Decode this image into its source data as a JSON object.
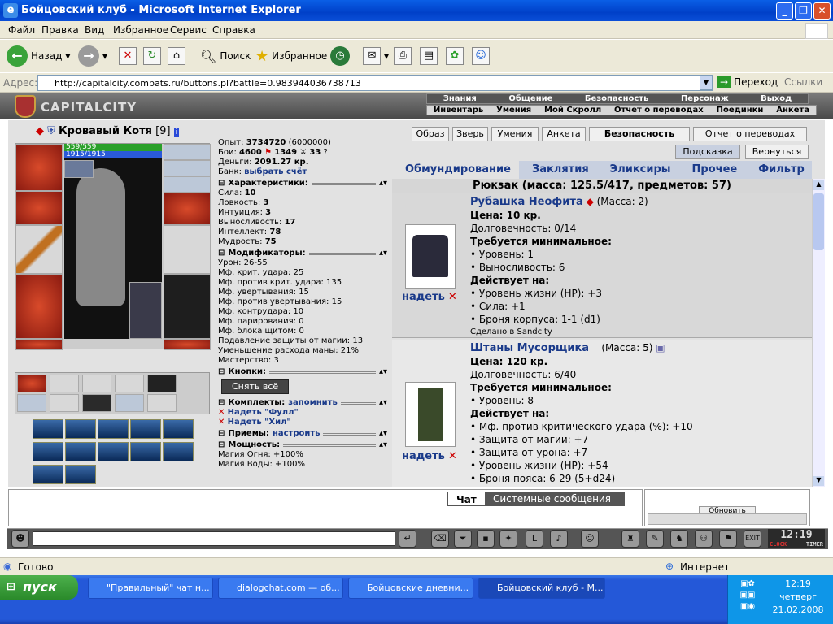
{
  "window": {
    "title": "Бойцовский клуб - Microsoft Internet Explorer"
  },
  "menu": [
    "Файл",
    "Правка",
    "Вид",
    "Избранное",
    "Сервис",
    "Справка"
  ],
  "toolbar": {
    "back": "Назад",
    "search": "Поиск",
    "favorites": "Избранное"
  },
  "address": {
    "label": "Адрес:",
    "url": "http://capitalcity.combats.ru/buttons.pl?battle=0.983944036738713",
    "go": "Переход",
    "links": "Ссылки"
  },
  "game": {
    "logo": "CAPITALCITY",
    "nav_top": [
      "Знания",
      "Общение",
      "Безопасность",
      "Персонаж",
      "Выход"
    ],
    "nav_bottom": [
      "Инвентарь",
      "Умения",
      "Мой Скролл",
      "Отчет о переводах",
      "Поединки",
      "Анкета"
    ]
  },
  "character": {
    "name": "Кровавый Котя",
    "level": "[9]",
    "hp": "559/559",
    "mana": "1915/1915",
    "exp_label": "Опыт:",
    "exp": "3734720",
    "exp_next": "(6000000)",
    "fights_label": "Бои:",
    "wins": "4600",
    "losses": "1349",
    "draws": "33",
    "money_label": "Деньги:",
    "money": "2091.27 кр.",
    "bank_label": "Банк:",
    "bank": "выбрать счёт"
  },
  "sections": {
    "chars": "Характеристики:",
    "mods": "Модификаторы:",
    "buttons": "Кнопки:",
    "sets": "Комплекты:",
    "sets_link": "запомнить",
    "moves": "Приемы:",
    "moves_link": "настроить",
    "power": "Мощность:"
  },
  "stats": [
    {
      "label": "Сила:",
      "value": "10"
    },
    {
      "label": "Ловкость:",
      "value": "3"
    },
    {
      "label": "Интуиция:",
      "value": "3"
    },
    {
      "label": "Выносливость:",
      "value": "17"
    },
    {
      "label": "Интеллект:",
      "value": "78"
    },
    {
      "label": "Мудрость:",
      "value": "75"
    }
  ],
  "modifiers": [
    "Урон: 26-55",
    "Мф. крит. удара: 25",
    "Мф. против крит. удара: 135",
    "Мф. увертывания: 15",
    "Мф. против увертывания: 15",
    "Мф. контрудара: 10",
    "Мф. парирования: 0",
    "Мф. блока щитом: 0",
    "Подавление защиты от магии: 13",
    "Уменьшение расхода маны: 21%",
    "Мастерство: 3"
  ],
  "remove_all": "Снять всё",
  "sets": [
    "Надеть \"Фулл\"",
    "Надеть \"Хил\""
  ],
  "power": [
    "Магия Огня: +100%",
    "Магия Воды: +100%"
  ],
  "right_buttons": [
    "Образ",
    "Зверь",
    "Умения",
    "Анкета",
    "Безопасность",
    "Отчет о переводах"
  ],
  "hint_buttons": [
    "Подсказка",
    "Вернуться"
  ],
  "inv_tabs": [
    "Обмундирование",
    "Заклятия",
    "Эликсиры",
    "Прочее",
    "Фильтр"
  ],
  "backpack": "Рюкзак (масса: 125.5/417, предметов: 57)",
  "wear_label": "надеть",
  "items": [
    {
      "name": "Рубашка Неофита",
      "mass": "(Масса: 2)",
      "price": "Цена: 10 кр.",
      "durability": "Долговечность: 0/14",
      "req_title": "Требуется минимальное:",
      "req": [
        "• Уровень: 1",
        "• Выносливость: 6"
      ],
      "eff_title": "Действует на:",
      "eff": [
        "• Уровень жизни (HP): +3",
        "• Сила: +1",
        "• Броня корпуса: 1-1 (d1)"
      ],
      "made": "Сделано в Sandcity"
    },
    {
      "name": "Штаны Мусорщика",
      "mass": "(Масса: 5)",
      "price": "Цена: 120 кр.",
      "durability": "Долговечность: 6/40",
      "req_title": "Требуется минимальное:",
      "req": [
        "• Уровень: 8"
      ],
      "eff_title": "Действует на:",
      "eff": [
        "• Мф. против критического удара (%): +10",
        "• Защита от магии: +7",
        "• Защита от урона: +7",
        "• Уровень жизни (HP): +54",
        "• Броня пояса: 6-29 (5+d24)"
      ]
    }
  ],
  "chat": {
    "tab1": "Чат",
    "tab2": "Системные сообщения",
    "update": "Обновить"
  },
  "clock": {
    "time": "12:19",
    "label1": "CLOCK",
    "label2": "TIMER"
  },
  "status": {
    "left": "Готово",
    "right": "Интернет"
  },
  "taskbar": {
    "start": "пуск",
    "tasks": [
      "\"Правильный\" чат н...",
      "dialogchat.com — об...",
      "Бойцовские дневни...",
      "Бойцовский клуб - M..."
    ],
    "time": "12:19",
    "day": "четверг",
    "date": "21.02.2008"
  }
}
